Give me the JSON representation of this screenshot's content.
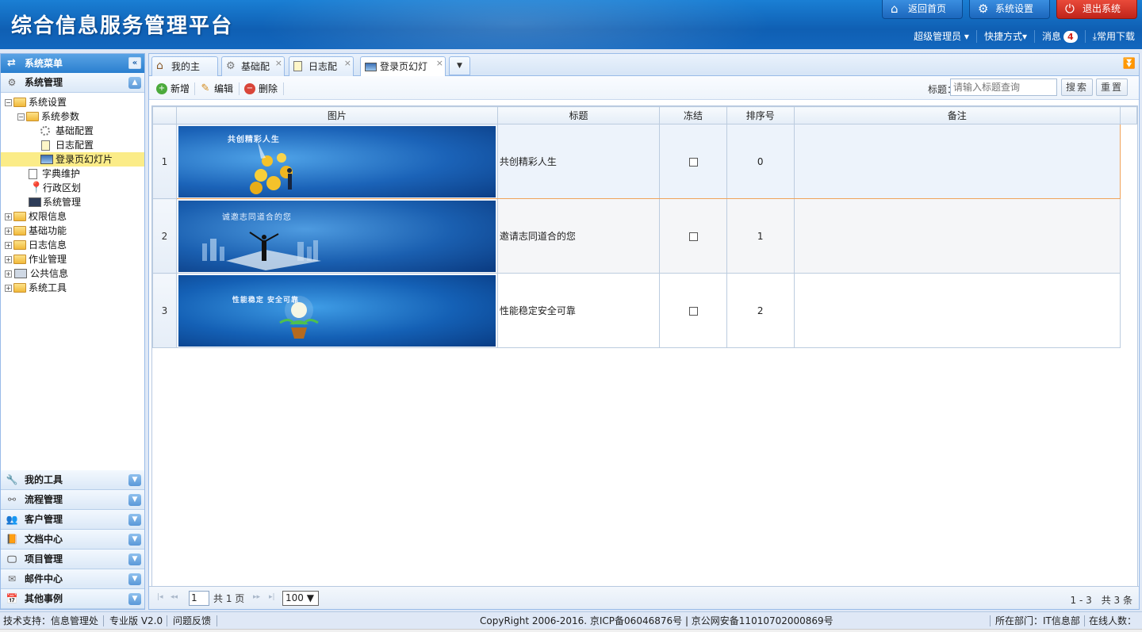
{
  "header": {
    "title": "综合信息服务管理平台",
    "home_label": "返回首页",
    "settings_label": "系统设置",
    "exit_label": "退出系统",
    "user_label": "超级管理员",
    "shortcut_label": "快捷方式",
    "messages_label": "消息",
    "messages_count": "4",
    "download_label": "常用下载"
  },
  "sidebar": {
    "title": "系统菜单",
    "section": "系统管理",
    "tree": {
      "n1": "系统设置",
      "n2": "系统参数",
      "n3": "基础配置",
      "n4": "日志配置",
      "n5": "登录页幻灯片",
      "n6": "字典维护",
      "n7": "行政区划",
      "n8": "系统管理",
      "n9": "权限信息",
      "n10": "基础功能",
      "n11": "日志信息",
      "n12": "作业管理",
      "n13": "公共信息",
      "n14": "系统工具"
    },
    "accordion": [
      "我的工具",
      "流程管理",
      "客户管理",
      "文档中心",
      "项目管理",
      "邮件中心",
      "其他事例"
    ]
  },
  "tabs": [
    "我的主页",
    "基础配置",
    "日志配置",
    "登录页幻灯片"
  ],
  "toolbar": {
    "add": "新增",
    "edit": "编辑",
    "delete": "删除",
    "search_label": "标题：",
    "search_placeholder": "请输入标题查询",
    "search_btn": "搜索",
    "reset_btn": "重置"
  },
  "grid": {
    "columns": [
      "图片",
      "标题",
      "冻结",
      "排序号",
      "备注"
    ],
    "rows": [
      {
        "no": "1",
        "caption": "共创精彩人生",
        "title": "共创精彩人生",
        "order": "0"
      },
      {
        "no": "2",
        "caption": "诚邀志同道合的您",
        "title": "邀请志同道合的您",
        "order": "1"
      },
      {
        "no": "3",
        "caption": "性能稳定 安全可靠",
        "title": "性能稳定安全可靠",
        "order": "2"
      }
    ]
  },
  "pager": {
    "page": "1",
    "total_pages": "共 1 页",
    "page_size": "100 ▼",
    "info": "1 - 3　共 3 条"
  },
  "footer": {
    "support": "技术支持：信息管理处",
    "edition": "专业版 V2.0",
    "feedback": "问题反馈",
    "copyright": "CopyRight 2006-2016. 京ICP备06046876号 | 京公网安备11010702000869号",
    "dept": "所在部门：IT信息部",
    "online": "在线人数："
  },
  "colors": {
    "header": "#0f5fb3",
    "exit": "#c0241a",
    "selected_row_border": "#f0a35a",
    "tree_selected": "#fbec88"
  }
}
